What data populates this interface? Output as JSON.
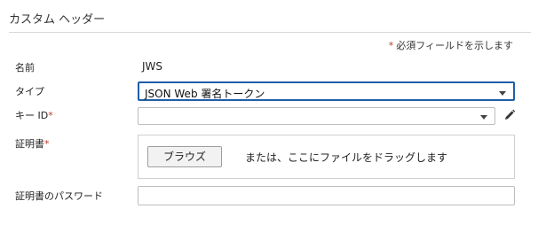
{
  "header": {
    "title": "カスタム ヘッダー"
  },
  "required_note": {
    "star": "*",
    "text": "必須フィールドを示します"
  },
  "fields": {
    "name": {
      "label": "名前",
      "value": "JWS"
    },
    "type": {
      "label": "タイプ",
      "selected": "JSON Web 署名トークン"
    },
    "key_id": {
      "label": "キー ID",
      "required_star": "*",
      "selected": "",
      "edit_icon": "pencil-icon"
    },
    "certificate": {
      "label": "証明書",
      "required_star": "*",
      "browse_label": "ブラウズ",
      "drop_text": "または、ここにファイルをドラッグします"
    },
    "certificate_password": {
      "label": "証明書のパスワード",
      "value": ""
    }
  },
  "colors": {
    "focus_border": "#1f5fa8",
    "required_star": "#c0392b"
  }
}
